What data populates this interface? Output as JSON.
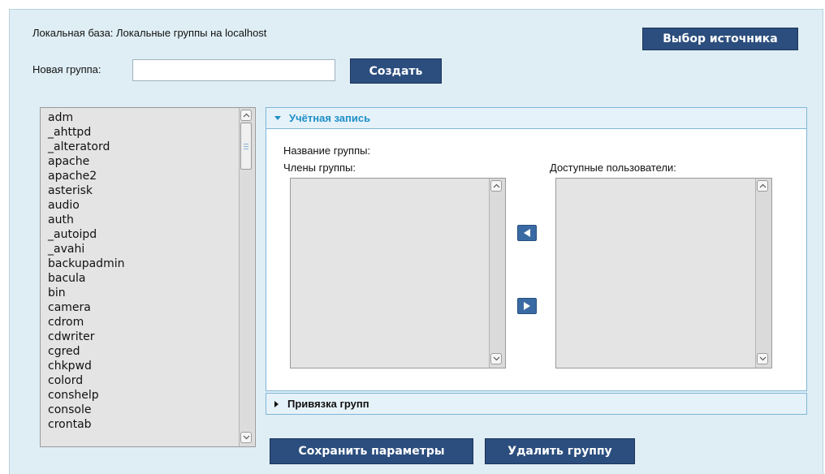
{
  "header": {
    "source_label": "Локальная база:  Локальные группы  на localhost",
    "choose_source_button": "Выбор источника"
  },
  "new_group": {
    "label": "Новая группа:",
    "value": "",
    "create_button": "Создать"
  },
  "groups": [
    "adm",
    "_ahttpd",
    "_alteratord",
    "apache",
    "apache2",
    "asterisk",
    "audio",
    "auth",
    "_autoipd",
    "_avahi",
    "backupadmin",
    "bacula",
    "bin",
    "camera",
    "cdrom",
    "cdwriter",
    "cgred",
    "chkpwd",
    "colord",
    "conshelp",
    "console",
    "crontab"
  ],
  "account_section": {
    "title": "Учётная запись",
    "group_name_label": "Название группы:",
    "members_label": "Члены группы:",
    "available_label": "Доступные пользователи:",
    "members": [],
    "available": []
  },
  "binding_section": {
    "title": "Привязка групп"
  },
  "actions": {
    "save_button": "Сохранить параметры",
    "delete_button": "Удалить группу"
  },
  "icons": {
    "move_left": "arrow-left-icon",
    "move_right": "arrow-right-icon",
    "scroll_up": "chevron-up-icon",
    "scroll_down": "chevron-down-icon"
  },
  "colors": {
    "panel_bg": "#dfeef5",
    "button_bg": "#2c4e7e",
    "section_border": "#7fb6d8",
    "section_title_accent": "#1f8fc7"
  }
}
